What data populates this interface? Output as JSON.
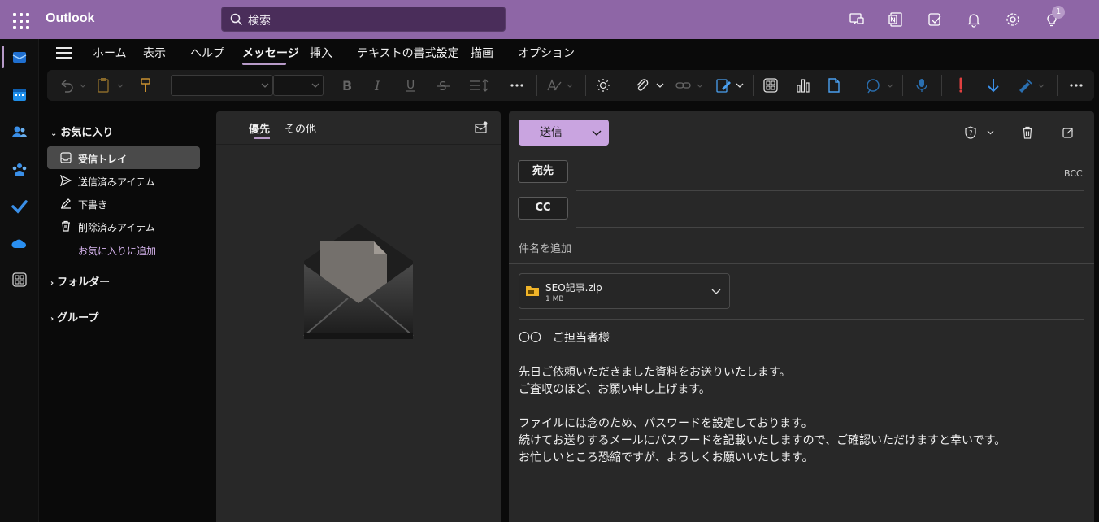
{
  "app": {
    "title": "Outlook"
  },
  "search": {
    "placeholder": "検索"
  },
  "notifications": {
    "badge_count": "1"
  },
  "tabs": [
    {
      "label": "ホーム"
    },
    {
      "label": "表示"
    },
    {
      "label": "ヘルプ"
    },
    {
      "label": "メッセージ",
      "active": true
    },
    {
      "label": "挿入"
    },
    {
      "label": "テキストの書式設定"
    },
    {
      "label": "描画"
    },
    {
      "label": "オプション"
    }
  ],
  "folders": {
    "favorites_header": "お気に入り",
    "items": [
      {
        "label": "受信トレイ",
        "icon": "inbox-icon",
        "selected": true
      },
      {
        "label": "送信済みアイテム",
        "icon": "send-icon"
      },
      {
        "label": "下書き",
        "icon": "pencil-icon"
      },
      {
        "label": "削除済みアイテム",
        "icon": "trash-icon"
      }
    ],
    "add_favorite": "お気に入りに追加",
    "folders_header": "フォルダー",
    "groups_header": "グループ"
  },
  "message_list": {
    "tabs": [
      {
        "label": "優先",
        "active": true
      },
      {
        "label": "その他"
      }
    ]
  },
  "compose": {
    "send_label": "送信",
    "to_label": "宛先",
    "cc_label": "CC",
    "bcc_label": "BCC",
    "subject_placeholder": "件名を追加",
    "attachment": {
      "name": "SEO記事.zip",
      "size": "1 MB"
    },
    "body": [
      "〇〇　ご担当者様",
      "",
      "先日ご依頼いただきました資料をお送りいたします。",
      "ご査収のほど、お願い申し上げます。",
      "",
      "ファイルには念のため、パスワードを設定しております。",
      "続けてお送りするメールにパスワードを記載いたしますので、ご確認いただけますと幸いです。",
      "お忙しいところ恐縮ですが、よろしくお願いいたします。"
    ]
  },
  "colors": {
    "brand": "#8e66a6",
    "accent": "#c9a4e0",
    "background": "#0a0a0a",
    "pane": "#282828"
  }
}
